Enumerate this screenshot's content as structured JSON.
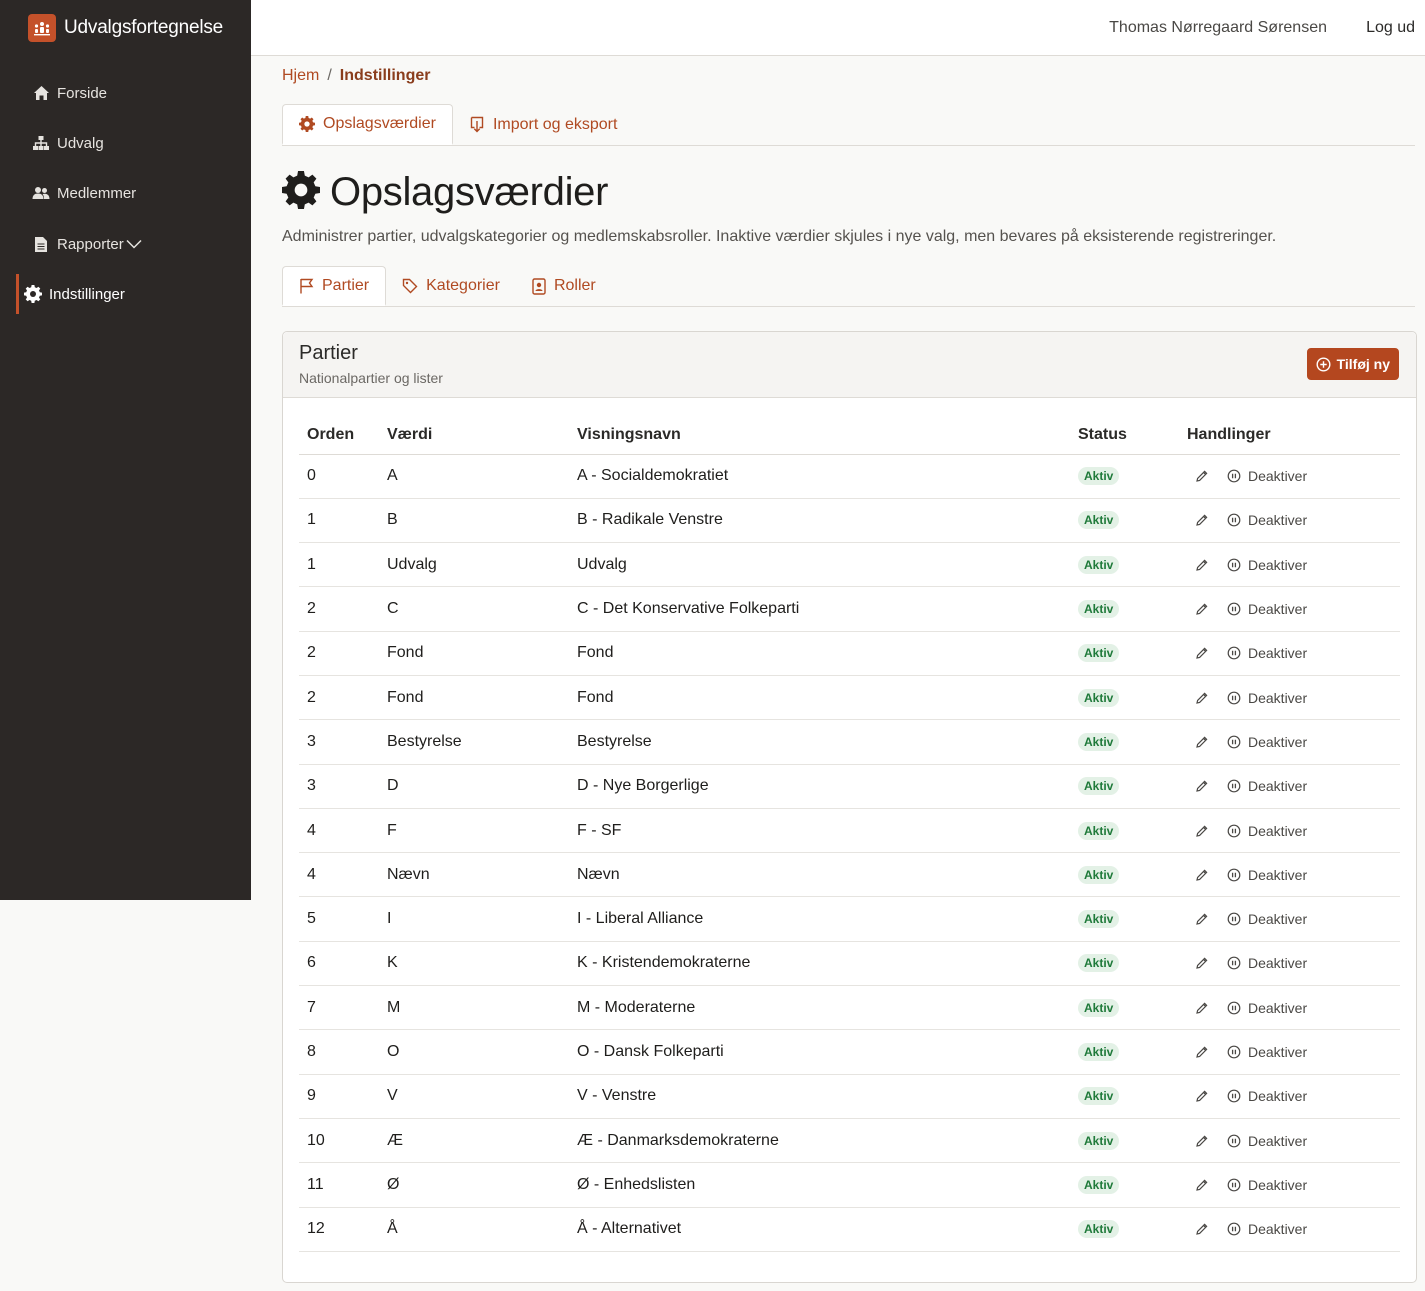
{
  "app": {
    "title": "Udvalgsfortegnelse",
    "logo_icon": "people-group-icon"
  },
  "nav": {
    "items": [
      {
        "label": "Forside",
        "icon": "home-icon"
      },
      {
        "label": "Udvalg",
        "icon": "sitemap-icon"
      },
      {
        "label": "Medlemmer",
        "icon": "users-icon"
      },
      {
        "label": "Rapporter",
        "icon": "file-icon"
      },
      {
        "label": "Indstillinger",
        "icon": "gear-icon",
        "active": true
      }
    ]
  },
  "topbar": {
    "user": "Thomas Nørregaard Sørensen",
    "logout": "Log ud"
  },
  "breadcrumb": {
    "home": "Hjem",
    "separator": "/",
    "current": "Indstillinger"
  },
  "top_tabs": [
    {
      "label": "Opslagsværdier",
      "icon": "gear-icon",
      "active": true
    },
    {
      "label": "Import og eksport",
      "icon": "import-export-icon",
      "active": false
    }
  ],
  "page": {
    "title": "Opslagsværdier",
    "description": "Administrer partier, udvalgskategorier og medlemskabsroller. Inaktive værdier skjules i nye valg, men bevares på eksisterende registreringer."
  },
  "sub_tabs": [
    {
      "label": "Partier",
      "icon": "flag-icon",
      "active": true
    },
    {
      "label": "Kategorier",
      "icon": "tag-icon",
      "active": false
    },
    {
      "label": "Roller",
      "icon": "id-badge-icon",
      "active": false
    }
  ],
  "card": {
    "title": "Partier",
    "subtitle": "Nationalpartier og lister",
    "add_button": "Tilføj ny"
  },
  "table": {
    "headers": {
      "order": "Orden",
      "value": "Værdi",
      "display": "Visningsnavn",
      "status": "Status",
      "actions": "Handlinger"
    },
    "rows": [
      {
        "order": "0",
        "value": "A",
        "display": "A - Socialdemokratiet",
        "status": "Aktiv",
        "action": "Deaktiver"
      },
      {
        "order": "1",
        "value": "B",
        "display": "B - Radikale Venstre",
        "status": "Aktiv",
        "action": "Deaktiver"
      },
      {
        "order": "1",
        "value": "Udvalg",
        "display": "Udvalg",
        "status": "Aktiv",
        "action": "Deaktiver"
      },
      {
        "order": "2",
        "value": "C",
        "display": "C - Det Konservative Folkeparti",
        "status": "Aktiv",
        "action": "Deaktiver"
      },
      {
        "order": "2",
        "value": "Fond",
        "display": "Fond",
        "status": "Aktiv",
        "action": "Deaktiver"
      },
      {
        "order": "2",
        "value": "Fond",
        "display": "Fond",
        "status": "Aktiv",
        "action": "Deaktiver"
      },
      {
        "order": "3",
        "value": "Bestyrelse",
        "display": "Bestyrelse",
        "status": "Aktiv",
        "action": "Deaktiver"
      },
      {
        "order": "3",
        "value": "D",
        "display": "D - Nye Borgerlige",
        "status": "Aktiv",
        "action": "Deaktiver"
      },
      {
        "order": "4",
        "value": "F",
        "display": "F - SF",
        "status": "Aktiv",
        "action": "Deaktiver"
      },
      {
        "order": "4",
        "value": "Nævn",
        "display": "Nævn",
        "status": "Aktiv",
        "action": "Deaktiver"
      },
      {
        "order": "5",
        "value": "I",
        "display": "I - Liberal Alliance",
        "status": "Aktiv",
        "action": "Deaktiver"
      },
      {
        "order": "6",
        "value": "K",
        "display": "K - Kristendemokraterne",
        "status": "Aktiv",
        "action": "Deaktiver"
      },
      {
        "order": "7",
        "value": "M",
        "display": "M - Moderaterne",
        "status": "Aktiv",
        "action": "Deaktiver"
      },
      {
        "order": "8",
        "value": "O",
        "display": "O - Dansk Folkeparti",
        "status": "Aktiv",
        "action": "Deaktiver"
      },
      {
        "order": "9",
        "value": "V",
        "display": "V - Venstre",
        "status": "Aktiv",
        "action": "Deaktiver"
      },
      {
        "order": "10",
        "value": "Æ",
        "display": "Æ - Danmarksdemokraterne",
        "status": "Aktiv",
        "action": "Deaktiver"
      },
      {
        "order": "11",
        "value": "Ø",
        "display": "Ø - Enhedslisten",
        "status": "Aktiv",
        "action": "Deaktiver"
      },
      {
        "order": "12",
        "value": "Å",
        "display": "Å - Alternativet",
        "status": "Aktiv",
        "action": "Deaktiver"
      }
    ]
  },
  "colors": {
    "sidebar_bg": "#2c2826",
    "accent": "#c4512a",
    "link": "#b04a22",
    "badge_bg": "#e3f1e6",
    "badge_text": "#1f7a3a"
  }
}
